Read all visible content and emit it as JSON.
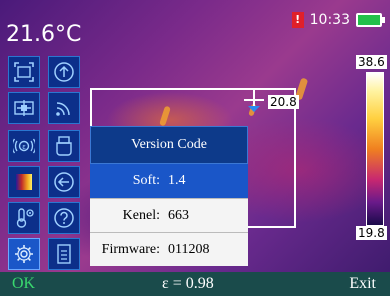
{
  "header": {
    "temperature": "21.6°C",
    "time": "10:33",
    "alert_glyph": "!"
  },
  "crosshair": {
    "value": "20.8"
  },
  "scale": {
    "max": "38.6",
    "min": "19.8"
  },
  "toolbar": [
    {
      "icon": "frame-icon"
    },
    {
      "icon": "upload-icon"
    },
    {
      "icon": "center-point-icon"
    },
    {
      "icon": "wifi-icon"
    },
    {
      "icon": "emissivity-icon"
    },
    {
      "icon": "usb-icon"
    },
    {
      "icon": "palette-icon"
    },
    {
      "icon": "back-icon"
    },
    {
      "icon": "temp-settings-icon"
    },
    {
      "icon": "help-icon"
    },
    {
      "icon": "settings-gear-icon"
    },
    {
      "icon": "document-icon"
    }
  ],
  "version_panel": {
    "title": "Version Code",
    "rows": [
      {
        "key": "Soft:",
        "value": "1.4"
      },
      {
        "key": "Kenel:",
        "value": "663"
      },
      {
        "key": "Firmware:",
        "value": "011208"
      }
    ]
  },
  "bottom_bar": {
    "ok_label": "OK",
    "emissivity": "ε = 0.98",
    "exit_label": "Exit"
  },
  "colors": {
    "accent_green": "#39d86e",
    "panel_blue": "#0d3a8a",
    "highlight_blue": "#1a56c8",
    "bottom_bar": "#1a4b4b"
  }
}
